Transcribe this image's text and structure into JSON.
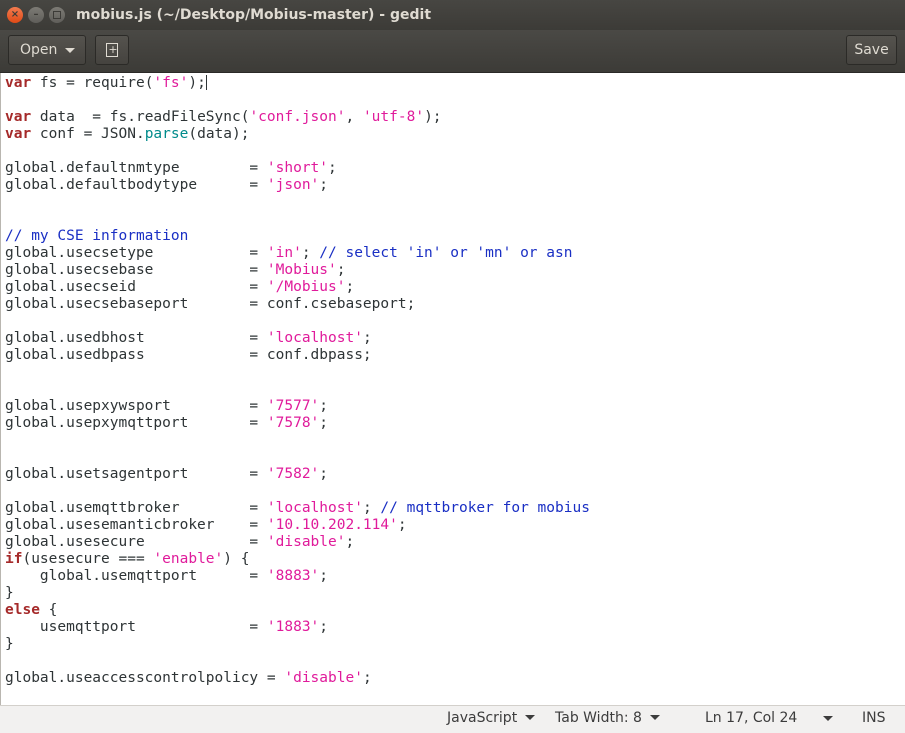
{
  "window": {
    "title": "mobius.js (~/Desktop/Mobius-master) - gedit",
    "close_glyph": "×",
    "min_glyph": "–"
  },
  "toolbar": {
    "open_label": "Open",
    "save_label": "Save",
    "new_tab_glyph": "+"
  },
  "editor": {
    "language": "JavaScript",
    "cursor": "Ln 17, Col 24",
    "lines": [
      [
        {
          "t": "kw",
          "v": "var"
        },
        {
          "t": "",
          "v": " fs = require("
        },
        {
          "t": "str",
          "v": "'fs'"
        },
        {
          "t": "",
          "v": ");"
        },
        {
          "t": "caret",
          "v": ""
        }
      ],
      [],
      [
        {
          "t": "kw",
          "v": "var"
        },
        {
          "t": "",
          "v": " data  = fs.readFileSync("
        },
        {
          "t": "str",
          "v": "'conf.json'"
        },
        {
          "t": "",
          "v": ", "
        },
        {
          "t": "str",
          "v": "'utf-8'"
        },
        {
          "t": "",
          "v": ");"
        }
      ],
      [
        {
          "t": "kw",
          "v": "var"
        },
        {
          "t": "",
          "v": " conf = JSON."
        },
        {
          "t": "fn",
          "v": "parse"
        },
        {
          "t": "",
          "v": "(data);"
        }
      ],
      [],
      [
        {
          "t": "",
          "v": "global.defaultnmtype        = "
        },
        {
          "t": "str",
          "v": "'short'"
        },
        {
          "t": "",
          "v": ";"
        }
      ],
      [
        {
          "t": "",
          "v": "global.defaultbodytype      = "
        },
        {
          "t": "str",
          "v": "'json'"
        },
        {
          "t": "",
          "v": ";"
        }
      ],
      [],
      [],
      [
        {
          "t": "cm",
          "v": "// my CSE information"
        }
      ],
      [
        {
          "t": "",
          "v": "global.usecsetype           = "
        },
        {
          "t": "str",
          "v": "'in'"
        },
        {
          "t": "",
          "v": "; "
        },
        {
          "t": "cm",
          "v": "// select 'in' or 'mn' or asn"
        }
      ],
      [
        {
          "t": "",
          "v": "global.usecsebase           = "
        },
        {
          "t": "str",
          "v": "'Mobius'"
        },
        {
          "t": "",
          "v": ";"
        }
      ],
      [
        {
          "t": "",
          "v": "global.usecseid             = "
        },
        {
          "t": "str",
          "v": "'/Mobius'"
        },
        {
          "t": "",
          "v": ";"
        }
      ],
      [
        {
          "t": "",
          "v": "global.usecsebaseport       = conf.csebaseport;"
        }
      ],
      [],
      [
        {
          "t": "",
          "v": "global.usedbhost            = "
        },
        {
          "t": "str",
          "v": "'localhost'"
        },
        {
          "t": "",
          "v": ";"
        }
      ],
      [
        {
          "t": "",
          "v": "global.usedbpass            = conf.dbpass;"
        }
      ],
      [],
      [],
      [
        {
          "t": "",
          "v": "global.usepxywsport         = "
        },
        {
          "t": "str",
          "v": "'7577'"
        },
        {
          "t": "",
          "v": ";"
        }
      ],
      [
        {
          "t": "",
          "v": "global.usepxymqttport       = "
        },
        {
          "t": "str",
          "v": "'7578'"
        },
        {
          "t": "",
          "v": ";"
        }
      ],
      [],
      [],
      [
        {
          "t": "",
          "v": "global.usetsagentport       = "
        },
        {
          "t": "str",
          "v": "'7582'"
        },
        {
          "t": "",
          "v": ";"
        }
      ],
      [],
      [
        {
          "t": "",
          "v": "global.usemqttbroker        = "
        },
        {
          "t": "str",
          "v": "'localhost'"
        },
        {
          "t": "",
          "v": "; "
        },
        {
          "t": "cm",
          "v": "// mqttbroker for mobius"
        }
      ],
      [
        {
          "t": "",
          "v": "global.usesemanticbroker    = "
        },
        {
          "t": "str",
          "v": "'10.10.202.114'"
        },
        {
          "t": "",
          "v": ";"
        }
      ],
      [
        {
          "t": "",
          "v": "global.usesecure            = "
        },
        {
          "t": "str",
          "v": "'disable'"
        },
        {
          "t": "",
          "v": ";"
        }
      ],
      [
        {
          "t": "kw",
          "v": "if"
        },
        {
          "t": "",
          "v": "(usesecure === "
        },
        {
          "t": "str",
          "v": "'enable'"
        },
        {
          "t": "",
          "v": ") {"
        }
      ],
      [
        {
          "t": "",
          "v": "    global.usemqttport      = "
        },
        {
          "t": "str",
          "v": "'8883'"
        },
        {
          "t": "",
          "v": ";"
        }
      ],
      [
        {
          "t": "",
          "v": "}"
        }
      ],
      [
        {
          "t": "kw",
          "v": "else"
        },
        {
          "t": "",
          "v": " {"
        }
      ],
      [
        {
          "t": "",
          "v": "    usemqttport             = "
        },
        {
          "t": "str",
          "v": "'1883'"
        },
        {
          "t": "",
          "v": ";"
        }
      ],
      [
        {
          "t": "",
          "v": "}"
        }
      ],
      [],
      [
        {
          "t": "",
          "v": "global.useaccesscontrolpolicy = "
        },
        {
          "t": "str",
          "v": "'disable'"
        },
        {
          "t": "",
          "v": ";"
        }
      ]
    ]
  },
  "statusbar": {
    "language_label": "JavaScript",
    "tab_width_label": "Tab Width: 8",
    "position_label": "Ln 17, Col 24",
    "mode_label": "INS"
  }
}
